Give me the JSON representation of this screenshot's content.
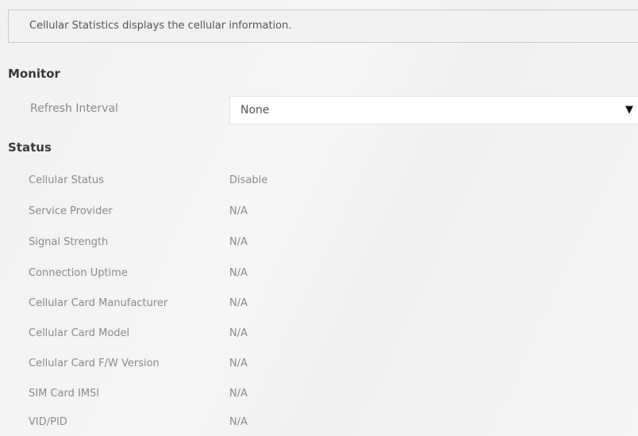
{
  "description": "Cellular Statistics displays the cellular information.",
  "monitor": {
    "title": "Monitor",
    "refresh_interval_label": "Refresh Interval",
    "refresh_interval_value": "None"
  },
  "status": {
    "title": "Status",
    "rows": [
      {
        "label": "Cellular Status",
        "value": "Disable"
      },
      {
        "label": "Service Provider",
        "value": "N/A"
      },
      {
        "label": "Signal Strength",
        "value": "N/A"
      },
      {
        "label": "Connection Uptime",
        "value": "N/A"
      },
      {
        "label": "Cellular Card Manufacturer",
        "value": "N/A"
      },
      {
        "label": "Cellular Card Model",
        "value": "N/A"
      },
      {
        "label": "Cellular Card F/W Version",
        "value": "N/A"
      },
      {
        "label": "SIM Card IMSI",
        "value": "N/A"
      },
      {
        "label": "VID/PID",
        "value": "N/A"
      }
    ]
  }
}
